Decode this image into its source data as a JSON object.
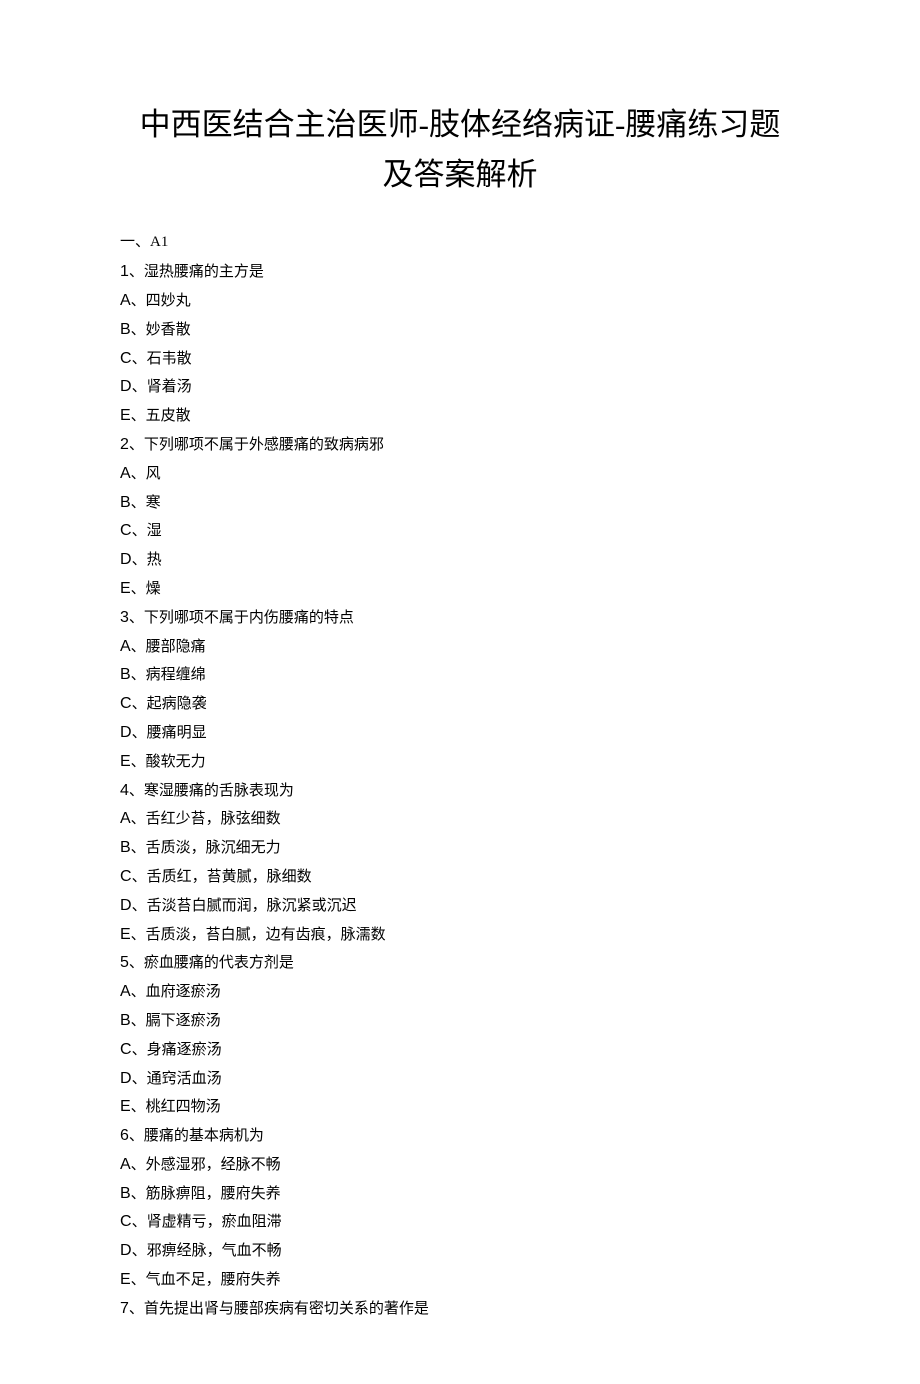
{
  "title_line1": "中西医结合主治医师-肢体经络病证-腰痛练习题",
  "title_line2": "及答案解析",
  "section_label": "一、A1",
  "questions": [
    {
      "num": "1",
      "stem": "、湿热腰痛的主方是",
      "options": [
        {
          "letter": "A",
          "text": "、四妙丸"
        },
        {
          "letter": "B",
          "text": "、妙香散"
        },
        {
          "letter": "C",
          "text": "、石韦散"
        },
        {
          "letter": "D",
          "text": "、肾着汤"
        },
        {
          "letter": "E",
          "text": "、五皮散"
        }
      ]
    },
    {
      "num": "2",
      "stem": "、下列哪项不属于外感腰痛的致病病邪",
      "options": [
        {
          "letter": "A",
          "text": "、风"
        },
        {
          "letter": "B",
          "text": "、寒"
        },
        {
          "letter": "C",
          "text": "、湿"
        },
        {
          "letter": "D",
          "text": "、热"
        },
        {
          "letter": "E",
          "text": "、燥"
        }
      ]
    },
    {
      "num": "3",
      "stem": "、下列哪项不属于内伤腰痛的特点",
      "options": [
        {
          "letter": "A",
          "text": "、腰部隐痛"
        },
        {
          "letter": "B",
          "text": "、病程缠绵"
        },
        {
          "letter": "C",
          "text": "、起病隐袭"
        },
        {
          "letter": "D",
          "text": "、腰痛明显"
        },
        {
          "letter": "E",
          "text": "、酸软无力"
        }
      ]
    },
    {
      "num": "4",
      "stem": "、寒湿腰痛的舌脉表现为",
      "options": [
        {
          "letter": "A",
          "text": "、舌红少苔，脉弦细数"
        },
        {
          "letter": "B",
          "text": "、舌质淡，脉沉细无力"
        },
        {
          "letter": "C",
          "text": "、舌质红，苔黄腻，脉细数"
        },
        {
          "letter": "D",
          "text": "、舌淡苔白腻而润，脉沉紧或沉迟"
        },
        {
          "letter": "E",
          "text": "、舌质淡，苔白腻，边有齿痕，脉濡数"
        }
      ]
    },
    {
      "num": "5",
      "stem": "、瘀血腰痛的代表方剂是",
      "options": [
        {
          "letter": "A",
          "text": "、血府逐瘀汤"
        },
        {
          "letter": "B",
          "text": "、膈下逐瘀汤"
        },
        {
          "letter": "C",
          "text": "、身痛逐瘀汤"
        },
        {
          "letter": "D",
          "text": "、通窍活血汤"
        },
        {
          "letter": "E",
          "text": "、桃红四物汤"
        }
      ]
    },
    {
      "num": "6",
      "stem": "、腰痛的基本病机为",
      "options": [
        {
          "letter": "A",
          "text": "、外感湿邪，经脉不畅"
        },
        {
          "letter": "B",
          "text": "、筋脉痹阻，腰府失养"
        },
        {
          "letter": "C",
          "text": "、肾虚精亏，瘀血阻滞"
        },
        {
          "letter": "D",
          "text": "、邪痹经脉，气血不畅"
        },
        {
          "letter": "E",
          "text": "、气血不足，腰府失养"
        }
      ]
    },
    {
      "num": "7",
      "stem": "、首先提出肾与腰部疾病有密切关系的著作是",
      "options": []
    }
  ]
}
